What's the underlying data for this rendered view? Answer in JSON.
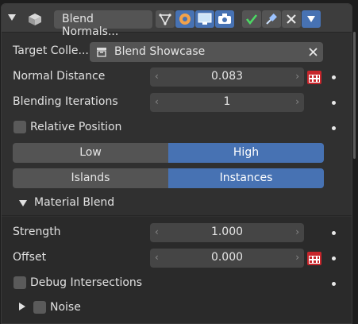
{
  "header": {
    "modifier_name": "Blend Normals...",
    "expand_icon": "chevron-down-icon",
    "cube_icon": "mesh-cube-icon"
  },
  "target_collection": {
    "label": "Target Colle...",
    "value": "Blend Showcase",
    "icon": "collection-box-icon"
  },
  "normal_distance": {
    "label": "Normal Distance",
    "value": "0.083"
  },
  "blending_iterations": {
    "label": "Blending Iterations",
    "value": "1"
  },
  "relative_position": {
    "label": "Relative Position"
  },
  "quality": {
    "low": "Low",
    "high": "High",
    "selected": "High"
  },
  "mode": {
    "islands": "Islands",
    "instances": "Instances",
    "selected": "Instances"
  },
  "material_blend": {
    "title": "Material Blend",
    "strength": {
      "label": "Strength",
      "value": "1.000"
    },
    "offset": {
      "label": "Offset",
      "value": "0.000"
    }
  },
  "debug_intersections": {
    "label": "Debug Intersections"
  },
  "noise": {
    "label": "Noise"
  },
  "colors": {
    "accent": "#4772b3",
    "panel": "#303030",
    "field": "#545454",
    "calendar": "#c8252b",
    "check_green": "#4cd964"
  }
}
